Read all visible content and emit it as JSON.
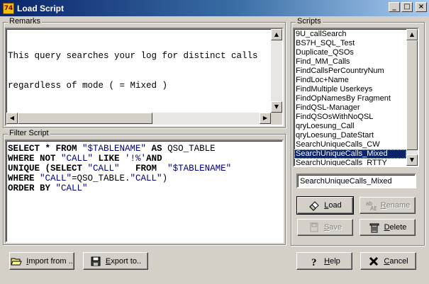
{
  "window": {
    "title": "Load Script",
    "app_icon_text": "74",
    "controls": {
      "minimize": "_",
      "maximize": "□",
      "close": "×"
    }
  },
  "remarks": {
    "label": "Remarks",
    "lines": [
      "This query searches your log for distinct calls",
      "regardless of mode ( = Mixed )"
    ]
  },
  "filter_script": {
    "label": "Filter Script",
    "lines": [
      [
        {
          "t": "SELECT * FROM ",
          "c": "kw"
        },
        {
          "t": "\"$TABLENAME\"",
          "c": "str"
        },
        {
          "t": " AS ",
          "c": "kw"
        },
        {
          "t": "QSO_TABLE",
          "c": "id"
        }
      ],
      [
        {
          "t": "WHERE NOT ",
          "c": "kw"
        },
        {
          "t": "\"CALL\"",
          "c": "str"
        },
        {
          "t": " LIKE ",
          "c": "kw"
        },
        {
          "t": "'!%'",
          "c": "str"
        },
        {
          "t": "AND",
          "c": "kw"
        }
      ],
      [
        {
          "t": "UNIQUE (SELECT ",
          "c": "kw"
        },
        {
          "t": "\"CALL\"",
          "c": "str"
        },
        {
          "t": "   FROM  ",
          "c": "kw"
        },
        {
          "t": "\"$TABLENAME\"",
          "c": "str"
        }
      ],
      [
        {
          "t": "WHERE ",
          "c": "kw"
        },
        {
          "t": "\"CALL\"",
          "c": "str"
        },
        {
          "t": "=QSO_TABLE.",
          "c": "id"
        },
        {
          "t": "\"CALL\"",
          "c": "str"
        },
        {
          "t": ")",
          "c": "id"
        }
      ],
      [
        {
          "t": "ORDER BY ",
          "c": "kw"
        },
        {
          "t": "\"CALL\"",
          "c": "str"
        }
      ]
    ]
  },
  "scripts": {
    "label": "Scripts",
    "items": [
      "9U_callSearch",
      "BS7H_SQL_Test",
      "Duplicate_QSOs",
      "Find_MM_Calls",
      "FindCallsPerCountryNum",
      "FindLoc+Name",
      "FindMultiple Userkeys",
      "FindOpNamesBy Fragment",
      "FindQSL-Manager",
      "FindQSOsWithNoQSL",
      "qryLoesung_Call",
      "qryLoesung_DateStart",
      "SearchUniqueCalls_CW",
      "SearchUniqueCalls_Mixed",
      "SearchUniqueCalls_RTTY"
    ],
    "selected_index": 13,
    "name_value": "SearchUniqueCalls_Mixed"
  },
  "buttons": {
    "load": {
      "pre": "",
      "ul": "L",
      "post": "oad",
      "icon": "eraser-icon"
    },
    "rename": {
      "pre": "",
      "ul": "R",
      "post": "ename",
      "icon": "rename-icon",
      "disabled": true
    },
    "save": {
      "pre": "",
      "ul": "S",
      "post": "ave",
      "icon": "save-disk-icon",
      "disabled": true
    },
    "delete": {
      "pre": "",
      "ul": "D",
      "post": "elete",
      "icon": "trash-icon"
    },
    "import": {
      "pre": "",
      "ul": "I",
      "post": "mport from ..",
      "icon": "open-folder-icon"
    },
    "export": {
      "pre": "",
      "ul": "E",
      "post": "xport to..",
      "icon": "floppy-disk-icon"
    },
    "help": {
      "pre": "",
      "ul": "H",
      "post": "elp",
      "icon": "question-mark-icon"
    },
    "cancel": {
      "pre": "",
      "ul": "C",
      "post": "ancel",
      "icon": "cancel-x-icon"
    }
  }
}
